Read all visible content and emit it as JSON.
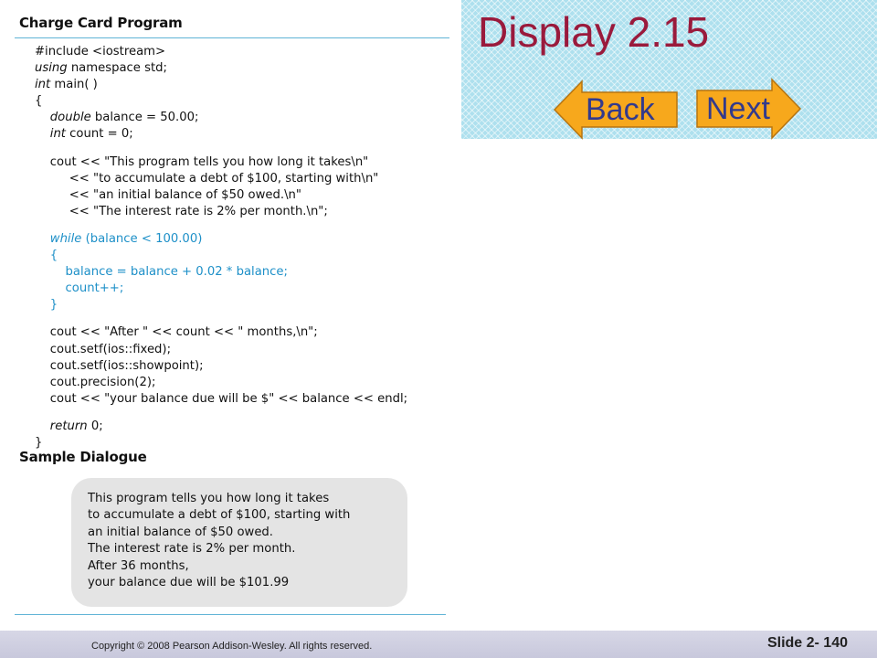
{
  "slide": {
    "section_title": "Charge Card Program",
    "dialogue_title": "Sample Dialogue",
    "code_lines": [
      {
        "text": "#include <iostream>",
        "style": "normal"
      },
      {
        "text": "using namespace std;",
        "style": "kw-first"
      },
      {
        "text": "int main( )",
        "style": "kw-first"
      },
      {
        "text": "{",
        "style": "normal"
      },
      {
        "text": "    double balance = 50.00;",
        "style": "kw-first"
      },
      {
        "text": "    int count = 0;",
        "style": "kw-first"
      },
      {
        "text": "",
        "style": "gap"
      },
      {
        "text": "    cout << \"This program tells you how long it takes\\n\"",
        "style": "normal"
      },
      {
        "text": "         << \"to accumulate a debt of $100, starting with\\n\"",
        "style": "normal"
      },
      {
        "text": "         << \"an initial balance of $50 owed.\\n\"",
        "style": "normal"
      },
      {
        "text": "         << \"The interest rate is 2% per month.\\n\";",
        "style": "normal"
      },
      {
        "text": "",
        "style": "gap"
      },
      {
        "text": "    while (balance < 100.00)",
        "style": "hl-kw"
      },
      {
        "text": "    {",
        "style": "hl"
      },
      {
        "text": "        balance = balance + 0.02 * balance;",
        "style": "hl"
      },
      {
        "text": "        count++;",
        "style": "hl"
      },
      {
        "text": "    }",
        "style": "hl"
      },
      {
        "text": "",
        "style": "gap"
      },
      {
        "text": "    cout << \"After \" << count << \" months,\\n\";",
        "style": "normal"
      },
      {
        "text": "    cout.setf(ios::fixed);",
        "style": "normal"
      },
      {
        "text": "    cout.setf(ios::showpoint);",
        "style": "normal"
      },
      {
        "text": "    cout.precision(2);",
        "style": "normal"
      },
      {
        "text": "    cout << \"your balance due will be $\" << balance << endl;",
        "style": "normal"
      },
      {
        "text": "",
        "style": "gap"
      },
      {
        "text": "    return 0;",
        "style": "kw-first"
      },
      {
        "text": "}",
        "style": "normal"
      }
    ],
    "dialogue_lines": [
      "This program tells you how long it takes",
      "to accumulate a debt of $100, starting with",
      "an initial balance of $50 owed.",
      "The interest rate is 2% per month.",
      "After 36 months,",
      "your balance due will be $101.99"
    ]
  },
  "header": {
    "title": "Display 2.15",
    "back_label": "Back",
    "next_label": "Next"
  },
  "footer": {
    "copyright": "Copyright © 2008 Pearson Addison-Wesley. All rights reserved.",
    "slide_number": "Slide 2- 140"
  },
  "colors": {
    "title": "#9a1a3c",
    "nav_button_fill": "#f7a81c",
    "nav_label": "#333a8c",
    "highlight_code": "#1e90c8",
    "header_bg": "#aee0ee"
  }
}
